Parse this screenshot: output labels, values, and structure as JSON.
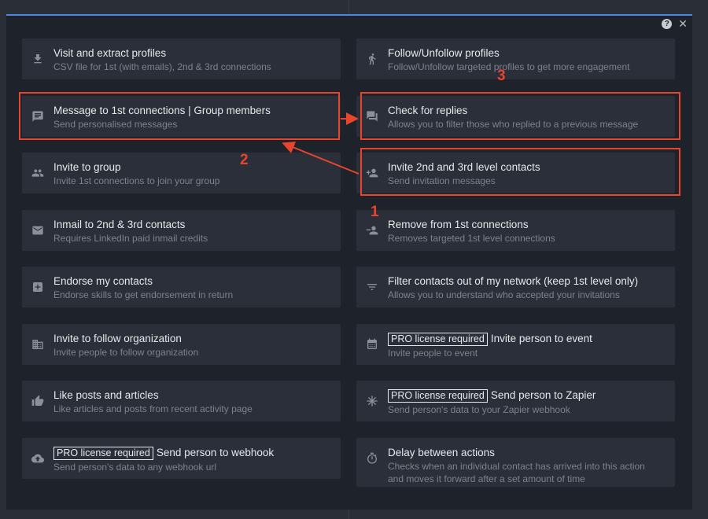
{
  "modal": {
    "help_glyph": "?",
    "close_glyph": "✕"
  },
  "left_column": [
    {
      "title": "Visit and extract profiles",
      "subtitle": "CSV file for 1st (with emails), 2nd & 3rd connections",
      "icon": "download-icon"
    },
    {
      "title": "Message to 1st connections | Group members",
      "subtitle": "Send personalised messages",
      "icon": "message-icon"
    },
    {
      "title": "Invite to group",
      "subtitle": "Invite 1st connections to join your group",
      "icon": "group-icon"
    },
    {
      "title": "Inmail to 2nd & 3rd contacts",
      "subtitle": "Requires LinkedIn paid inmail credits",
      "icon": "mail-icon"
    },
    {
      "title": "Endorse my contacts",
      "subtitle": "Endorse skills to get endorsement in return",
      "icon": "plus-box-icon"
    },
    {
      "title": "Invite to follow organization",
      "subtitle": "Invite people to follow organization",
      "icon": "building-icon"
    },
    {
      "title": "Like posts and articles",
      "subtitle": "Like articles and posts from recent activity page",
      "icon": "thumb-up-icon"
    },
    {
      "pro": "PRO license required",
      "title": "Send person to webhook",
      "subtitle": "Send person's data to any webhook url",
      "icon": "cloud-upload-icon"
    }
  ],
  "right_column": [
    {
      "title": "Follow/Unfollow profiles",
      "subtitle": "Follow/Unfollow targeted profiles to get more engagement",
      "icon": "walk-icon"
    },
    {
      "title": "Check for replies",
      "subtitle": "Allows you to filter those who replied to a previous message",
      "icon": "forum-icon"
    },
    {
      "title": "Invite 2nd and 3rd level contacts",
      "subtitle": "Send invitation messages",
      "icon": "person-add-icon"
    },
    {
      "title": "Remove from 1st connections",
      "subtitle": "Removes targeted 1st level connections",
      "icon": "person-remove-icon"
    },
    {
      "title": "Filter contacts out of my network (keep 1st level only)",
      "subtitle": "Allows you to understand who accepted your invitations",
      "icon": "filter-icon"
    },
    {
      "pro": "PRO license required",
      "title": "Invite person to event",
      "subtitle": "Invite people to event",
      "icon": "calendar-icon"
    },
    {
      "pro": "PRO license required",
      "title": "Send person to Zapier",
      "subtitle": "Send person's data to your Zapier webhook",
      "icon": "asterisk-icon"
    },
    {
      "title": "Delay between actions",
      "subtitle": "Checks when an individual contact has arrived into this action",
      "subtitle2": "and moves it forward after a set amount of time",
      "icon": "timer-icon"
    }
  ],
  "annotations": {
    "step1": "1",
    "step2": "2",
    "step3": "3",
    "color": "#e8452c"
  }
}
